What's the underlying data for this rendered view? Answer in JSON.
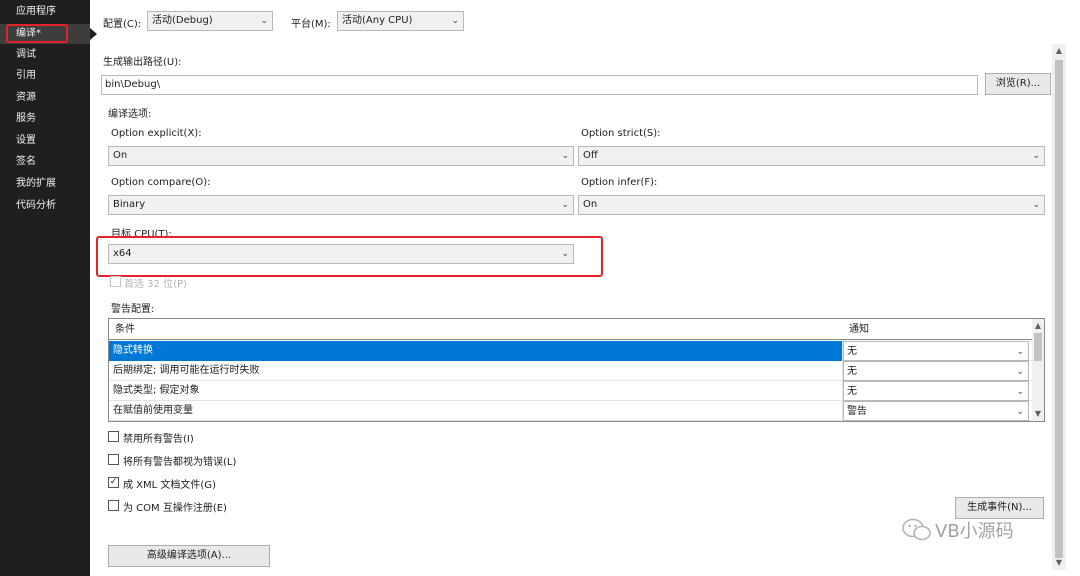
{
  "sidebar": {
    "items": [
      {
        "label": "应用程序"
      },
      {
        "label": "编译*"
      },
      {
        "label": "调试"
      },
      {
        "label": "引用"
      },
      {
        "label": "资源"
      },
      {
        "label": "服务"
      },
      {
        "label": "设置"
      },
      {
        "label": "签名"
      },
      {
        "label": "我的扩展"
      },
      {
        "label": "代码分析"
      }
    ],
    "active_index": 1
  },
  "toolbar": {
    "config_label": "配置(C):",
    "config_value": "活动(Debug)",
    "platform_label": "平台(M):",
    "platform_value": "活动(Any CPU)"
  },
  "output": {
    "label": "生成输出路径(U):",
    "value": "bin\\Debug\\",
    "browse_label": "浏览(R)..."
  },
  "compile_options": {
    "label": "编译选项:",
    "option_explicit_label": "Option explicit(X):",
    "option_explicit_value": "On",
    "option_strict_label": "Option strict(S):",
    "option_strict_value": "Off",
    "option_compare_label": "Option compare(O):",
    "option_compare_value": "Binary",
    "option_infer_label": "Option infer(F):",
    "option_infer_value": "On",
    "target_cpu_label": "目标 CPU(T):",
    "target_cpu_value": "x64",
    "prefer32_label": "首选 32 位(P)"
  },
  "warnings": {
    "label": "警告配置:",
    "columns": [
      "条件",
      "通知"
    ],
    "rows": [
      {
        "condition": "隐式转换",
        "notify": "无"
      },
      {
        "condition": "后期绑定; 调用可能在运行时失败",
        "notify": "无"
      },
      {
        "condition": "隐式类型; 假定对象",
        "notify": "无"
      },
      {
        "condition": "在赋值前使用变量",
        "notify": "警告"
      }
    ]
  },
  "checkboxes": [
    {
      "label": "禁用所有警告(I)",
      "checked": false
    },
    {
      "label": "将所有警告都视为错误(L)",
      "checked": false
    },
    {
      "label": "成 XML 文档文件(G)",
      "checked": true
    },
    {
      "label": "为 COM 互操作注册(E)",
      "checked": false
    }
  ],
  "buttons": {
    "build_events": "生成事件(N)...",
    "advanced": "高级编译选项(A)..."
  },
  "watermark": "VB小源码",
  "icons": {
    "chevron": "chevron-down-icon",
    "check": "checkmark-icon"
  },
  "colors": {
    "sidebar_bg": "#1f1f1f",
    "selection": "#0078d7",
    "highlight_box": "#e0242a"
  }
}
